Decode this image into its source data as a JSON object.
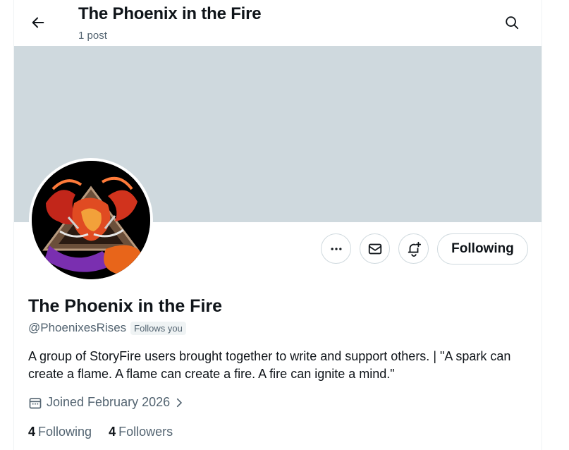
{
  "header": {
    "title": "The Phoenix in the Fire",
    "subtitle": "1 post"
  },
  "profile": {
    "display_name": "The Phoenix in the Fire",
    "handle": "@PhoenixesRises",
    "follows_badge": "Follows you",
    "bio": "A group of StoryFire users brought together to write and support others. | \"A spark can create a flame. A flame can create a fire. A fire can ignite a mind.\"",
    "joined": "Joined February 2026",
    "following_count": "4",
    "following_label": "Following",
    "followers_count": "4",
    "followers_label": "Followers"
  },
  "actions": {
    "following_button": "Following",
    "icons": [
      "more-icon",
      "mail-icon",
      "bell-plus-icon"
    ]
  },
  "colors": {
    "banner": "#cfd9de",
    "secondary_text": "#536471",
    "primary_text": "#0f1419"
  }
}
